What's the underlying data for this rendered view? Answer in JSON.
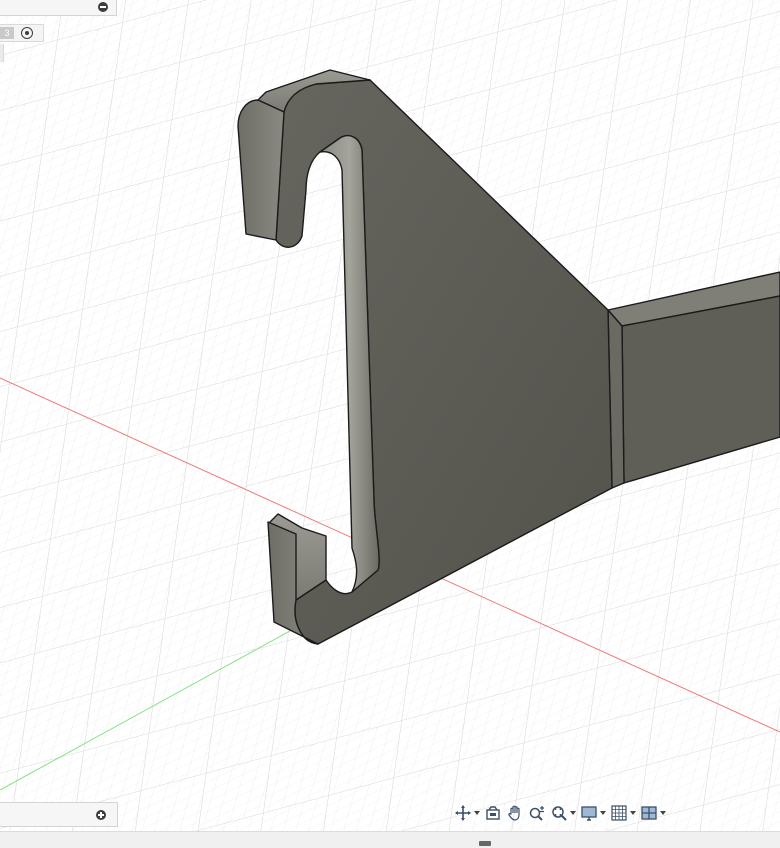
{
  "browser_panel": {
    "collapse_icon": "minus-circle-icon"
  },
  "view_controls": {
    "value": "3",
    "target_icon": "target-radio-icon"
  },
  "comments_panel": {
    "add_icon": "plus-circle-icon"
  },
  "nav_toolbar": {
    "tools": [
      {
        "name": "orbit-tool",
        "icon": "orbit-icon",
        "has_dropdown": true
      },
      {
        "name": "look-at-tool",
        "icon": "look-at-icon",
        "has_dropdown": false
      },
      {
        "name": "pan-tool",
        "icon": "hand-icon",
        "has_dropdown": false
      },
      {
        "name": "zoom-tool",
        "icon": "zoom-icon",
        "has_dropdown": false
      },
      {
        "name": "fit-tool",
        "icon": "fit-zoom-icon",
        "has_dropdown": true
      },
      {
        "name": "display-settings",
        "icon": "monitor-icon",
        "has_dropdown": true
      },
      {
        "name": "grid-settings",
        "icon": "grid-icon",
        "has_dropdown": true
      },
      {
        "name": "viewports",
        "icon": "viewports-icon",
        "has_dropdown": true
      }
    ]
  },
  "colors": {
    "background": "#ffffff",
    "grid_line": "#e1e1e1",
    "x_axis": "#ef7a7a",
    "y_axis": "#86e286",
    "body_face": "#5b5a53",
    "body_edge": "#1b1b1b"
  }
}
